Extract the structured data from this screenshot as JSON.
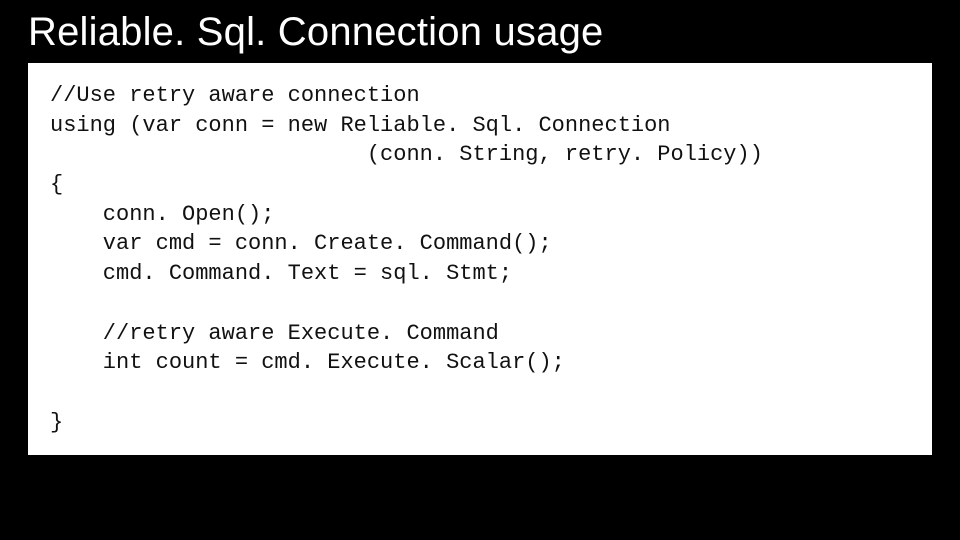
{
  "slide": {
    "title": "Reliable. Sql. Connection usage",
    "code": "//Use retry aware connection\nusing (var conn = new Reliable. Sql. Connection\n                        (conn. String, retry. Policy))\n{\n    conn. Open();\n    var cmd = conn. Create. Command();\n    cmd. Command. Text = sql. Stmt;\n\n    //retry aware Execute. Command\n    int count = cmd. Execute. Scalar();\n\n}"
  }
}
